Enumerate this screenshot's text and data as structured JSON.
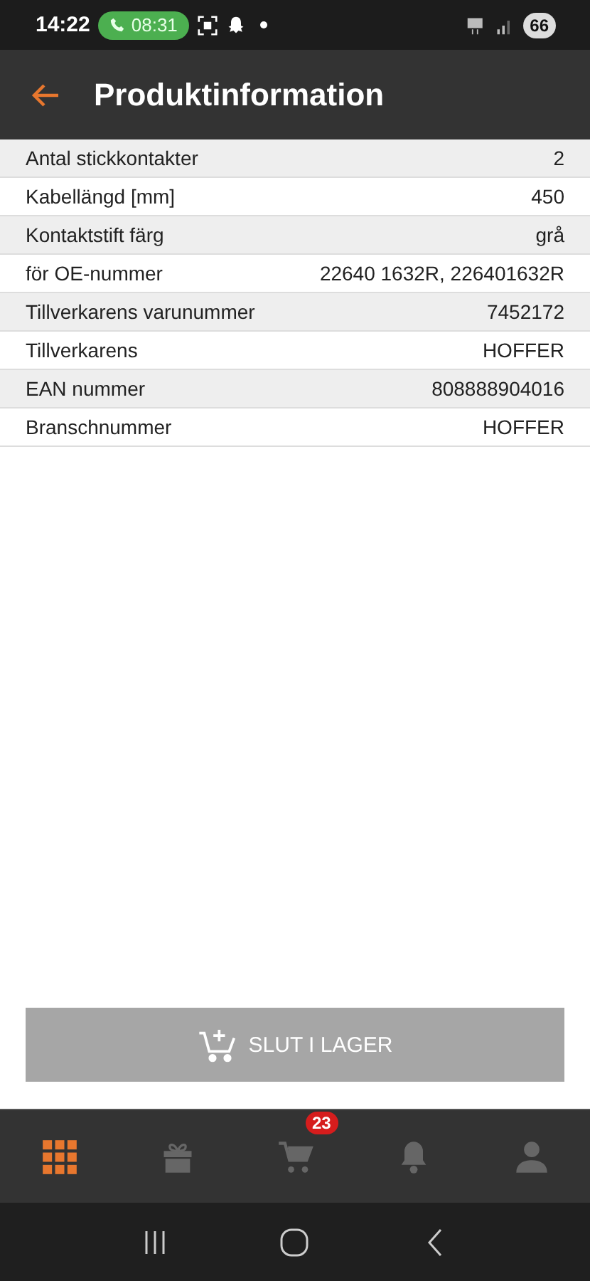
{
  "status_bar": {
    "time": "14:22",
    "call_time": "08:31",
    "battery": "66"
  },
  "app_bar": {
    "title": "Produktinformation"
  },
  "rows": [
    {
      "label": "Antal stickkontakter",
      "value": "2"
    },
    {
      "label": "Kabellängd [mm]",
      "value": "450"
    },
    {
      "label": "Kontaktstift färg",
      "value": "grå"
    },
    {
      "label": "för OE-nummer",
      "value": "22640 1632R, 226401632R"
    },
    {
      "label": "Tillverkarens varunummer",
      "value": "7452172"
    },
    {
      "label": "Tillverkarens",
      "value": "HOFFER"
    },
    {
      "label": "EAN nummer",
      "value": "808888904016"
    },
    {
      "label": "Branschnummer",
      "value": "HOFFER"
    }
  ],
  "action_button": {
    "label": "SLUT I LAGER",
    "disabled": true
  },
  "bottom_nav": [
    {
      "kind": "grid",
      "selected": true
    },
    {
      "kind": "gift",
      "selected": false
    },
    {
      "kind": "cart",
      "selected": false,
      "badge": "23"
    },
    {
      "kind": "bell",
      "selected": false
    },
    {
      "kind": "person",
      "selected": false
    }
  ]
}
